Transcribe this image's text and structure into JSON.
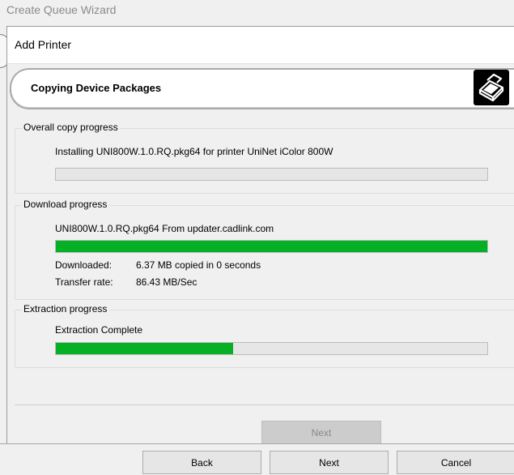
{
  "outer_window": {
    "title": "Create Queue Wizard"
  },
  "dialog": {
    "title": "Add Printer",
    "header": "Copying Device Packages",
    "overall": {
      "label": "Overall copy progress",
      "status_text": "Installing UNI800W.1.0.RQ.pkg64 for printer UniNet iColor 800W",
      "progress": 0
    },
    "download": {
      "label": "Download progress",
      "status_text": "UNI800W.1.0.RQ.pkg64 From updater.cadlink.com",
      "progress": 1.0,
      "downloaded_label": "Downloaded:",
      "downloaded_value": "6.37 MB copied in 0 seconds",
      "rate_label": "Transfer rate:",
      "rate_value": "86.43 MB/Sec"
    },
    "extraction": {
      "label": "Extraction progress",
      "status_text": "Extraction Complete",
      "progress": 0.41
    },
    "next_button": "Next"
  },
  "outer_buttons": {
    "back": "Back",
    "next": "Next",
    "cancel": "Cancel"
  },
  "colors": {
    "progress_fill": "#06b025",
    "track": "#e6e6e6",
    "background": "#f0f0f0"
  },
  "icons": {
    "header": "printer-icon"
  }
}
